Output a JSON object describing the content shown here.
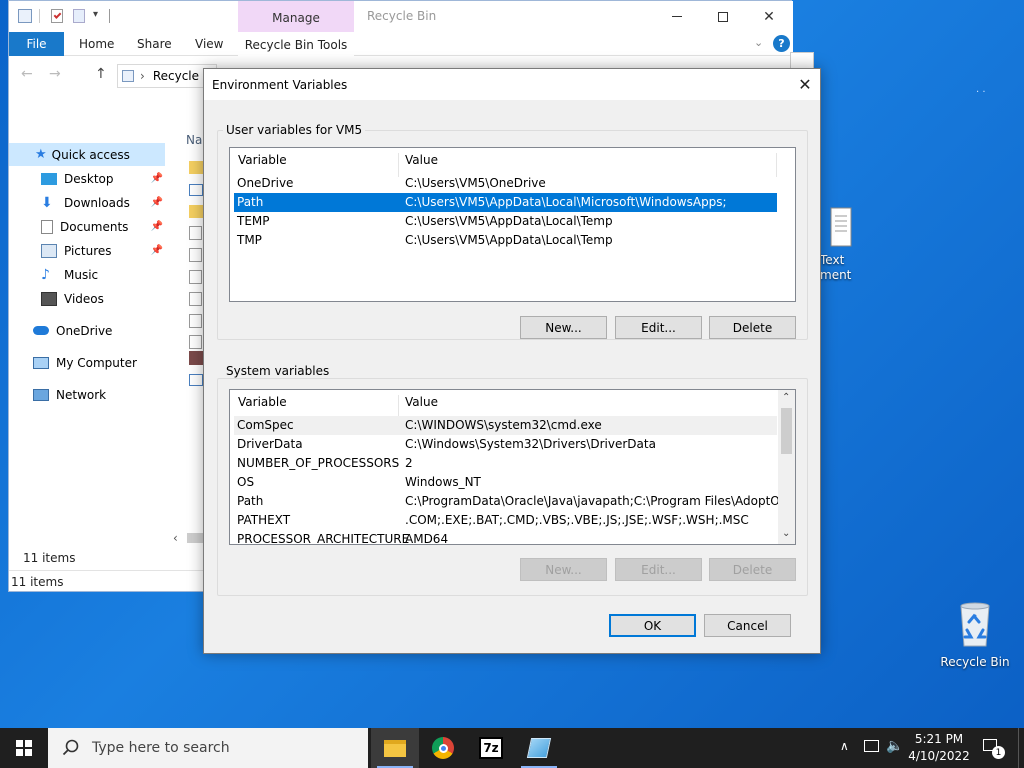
{
  "desktop": {
    "recycle_bin_label": "Recycle Bin",
    "text_doc_label_1": "Text",
    "text_doc_label_2": "ment"
  },
  "explorer": {
    "title": "Recycle Bin",
    "ribbon": {
      "file": "File",
      "home": "Home",
      "share": "Share",
      "view": "View",
      "manage": "Manage",
      "tools": "Recycle Bin Tools"
    },
    "address": "Recycle B",
    "column_name": "Nar",
    "nav": {
      "quick_access": "Quick access",
      "desktop": "Desktop",
      "downloads": "Downloads",
      "documents": "Documents",
      "pictures": "Pictures",
      "music": "Music",
      "videos": "Videos",
      "onedrive": "OneDrive",
      "my_computer": "My Computer",
      "network": "Network"
    },
    "status_items": "11 items",
    "status_bar": "11 items"
  },
  "dialog": {
    "title": "Environment Variables",
    "user_group_label": "User variables for VM5",
    "user_columns": [
      "Variable",
      "Value"
    ],
    "user_rows": [
      {
        "name": "OneDrive",
        "value": "C:\\Users\\VM5\\OneDrive"
      },
      {
        "name": "Path",
        "value": "C:\\Users\\VM5\\AppData\\Local\\Microsoft\\WindowsApps;"
      },
      {
        "name": "TEMP",
        "value": "C:\\Users\\VM5\\AppData\\Local\\Temp"
      },
      {
        "name": "TMP",
        "value": "C:\\Users\\VM5\\AppData\\Local\\Temp"
      }
    ],
    "user_buttons": {
      "new": "New...",
      "edit": "Edit...",
      "delete": "Delete"
    },
    "system_group_label": "System variables",
    "system_columns": [
      "Variable",
      "Value"
    ],
    "system_rows": [
      {
        "name": "ComSpec",
        "value": "C:\\WINDOWS\\system32\\cmd.exe"
      },
      {
        "name": "DriverData",
        "value": "C:\\Windows\\System32\\Drivers\\DriverData"
      },
      {
        "name": "NUMBER_OF_PROCESSORS",
        "value": "2"
      },
      {
        "name": "OS",
        "value": "Windows_NT"
      },
      {
        "name": "Path",
        "value": "C:\\ProgramData\\Oracle\\Java\\javapath;C:\\Program Files\\AdoptOpe..."
      },
      {
        "name": "PATHEXT",
        "value": ".COM;.EXE;.BAT;.CMD;.VBS;.VBE;.JS;.JSE;.WSF;.WSH;.MSC"
      },
      {
        "name": "PROCESSOR_ARCHITECTURE",
        "value": "AMD64"
      }
    ],
    "system_buttons": {
      "new": "New...",
      "edit": "Edit...",
      "delete": "Delete"
    },
    "ok": "OK",
    "cancel": "Cancel"
  },
  "taskbar": {
    "search_placeholder": "Type here to search",
    "clock_time": "5:21 PM",
    "clock_date": "4/10/2022",
    "notification_count": "1",
    "apps": [
      "file-explorer-icon",
      "chrome-icon",
      "7zip-icon",
      "notepad-icon"
    ]
  },
  "colors": {
    "selection": "#0078d7",
    "file_tab": "#1979ca",
    "manage_tab": "#f1d8f7",
    "taskbar": "#1f1f1f"
  }
}
